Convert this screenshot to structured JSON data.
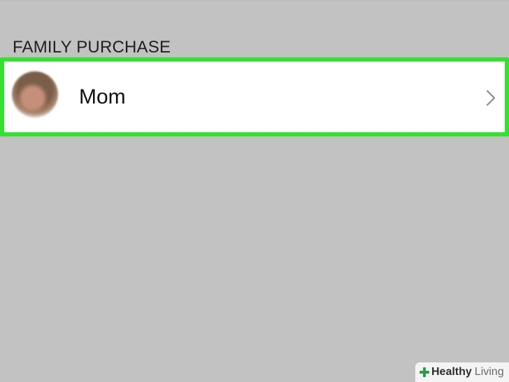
{
  "section": {
    "title": "FAMILY PURCHASE"
  },
  "member": {
    "name": "Mom"
  },
  "watermark": {
    "brand_strong": "Healthy",
    "brand_light": "Living"
  },
  "icons": {
    "avatar": "profile-avatar",
    "chevron": "chevron-right-icon",
    "watermark_mark": "medical-cross-icon"
  },
  "colors": {
    "background": "#c2c2c2",
    "highlight_border": "#35e030",
    "row_background": "#ffffff",
    "text": "#111111",
    "header_text": "#1f1f1f",
    "chevron": "#8b8b8b",
    "watermark_green": "#2e9a4f"
  }
}
